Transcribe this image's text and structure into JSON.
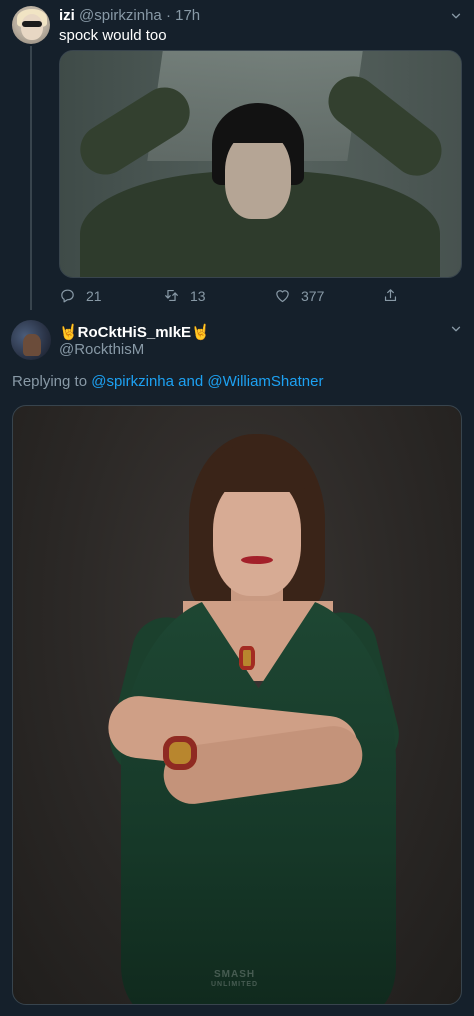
{
  "tweet1": {
    "display_name": "izi",
    "handle": "@spirkzinha",
    "separator": "·",
    "time": "17h",
    "text": "spock would too",
    "media_icon": "image-photo",
    "actions": {
      "reply_count": "21",
      "retweet_count": "13",
      "like_count": "377"
    }
  },
  "tweet2": {
    "display_name": "🤘RoCktHiS_mIkE🤘",
    "handle": "@RockthisM",
    "replying_prefix": "Replying to",
    "mention1": "@spirkzinha",
    "conjunction": "and",
    "mention2": "@WilliamShatner",
    "media_watermark_line1": "SMASH",
    "media_watermark_line2": "UNLIMITED"
  },
  "theme": {
    "background": "#15202b",
    "muted_text": "#8899a6",
    "accent": "#1da1f2",
    "border": "#38444d"
  }
}
